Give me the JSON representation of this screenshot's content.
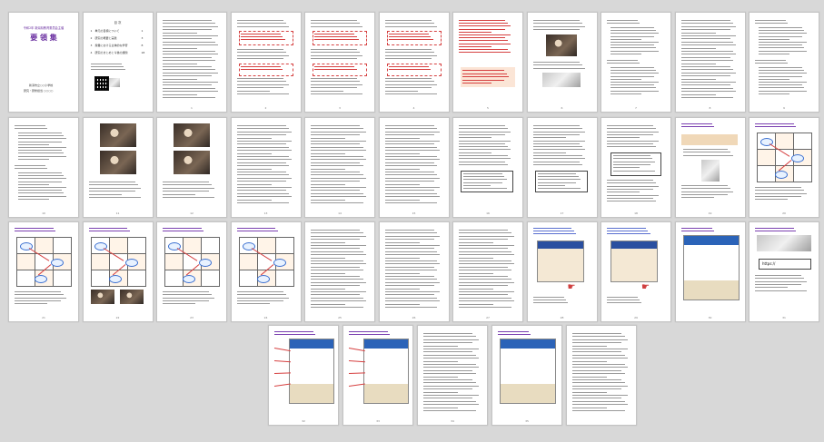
{
  "viewer": {
    "title": "",
    "layout": "thumbnail-grid",
    "background_color": "#d8d8d8",
    "accent_color": "#6a2fa0",
    "highlight_color": "#d64040"
  },
  "cover": {
    "line1": "令和2年 新潟県教育委員会主催",
    "line2": "要 領 集",
    "line3": "新潟市立○○小学校",
    "line4": "研究・研修担当 ○○○○"
  },
  "toc": {
    "heading": "目 次",
    "items": [
      {
        "no": "1",
        "text": "単元の目標について",
        "page": "1"
      },
      {
        "no": "2",
        "text": "研究の概要と実践",
        "page": "3"
      },
      {
        "no": "3",
        "text": "授業における主体的な学習",
        "page": "8"
      },
      {
        "no": "4",
        "text": "研究のまとめと今後の課題",
        "page": "18"
      }
    ]
  },
  "headings": {
    "p3": "1.単元の目標について",
    "p4": "(1) 単元の評価規準を設定する",
    "p5": "(2) Google Classroomの活用",
    "p6": "(3) 学習の記録と評価",
    "p7": "(4) 振り返りシートの作成",
    "p10": "研究テーマ",
    "p11": "2.研究の概要と実践",
    "p12": "(1) 研究の目的",
    "p15": "3.研究の成果と課題",
    "p19": "(2) 研究の内容と方法",
    "p20": "(3) 授業の実際",
    "p22": "4.研究のまとめ",
    "p23": "新潟市立ネットの案内",
    "p24": "(4) 学習の成果を共有する",
    "p25": "(5) 学習活動を分類する",
    "p26": "(6) 活動の整理",
    "p34": "(7) 実践の事例",
    "p36": "URL 入力画面",
    "p37": "https://"
  },
  "page_numbers": [
    "",
    "",
    "1",
    "2",
    "3",
    "4",
    "5",
    "6",
    "7",
    "8",
    "9",
    "10",
    "11",
    "12",
    "13",
    "14",
    "15",
    "16",
    "17",
    "18",
    "19",
    "20",
    "21",
    "22",
    "23",
    "24",
    "25",
    "26",
    "27",
    "28",
    "29",
    "30",
    "31",
    "32",
    "33",
    "34",
    "35",
    ""
  ],
  "thumbnails": [
    {
      "name": "page-1",
      "kind": "cover"
    },
    {
      "name": "page-2",
      "kind": "toc"
    },
    {
      "name": "page-3",
      "kind": "text"
    },
    {
      "name": "page-4",
      "kind": "text-redbox"
    },
    {
      "name": "page-5",
      "kind": "text-redbox"
    },
    {
      "name": "page-6",
      "kind": "text-redbox"
    },
    {
      "name": "page-7",
      "kind": "text-red-photo"
    },
    {
      "name": "page-8",
      "kind": "photo-text"
    },
    {
      "name": "page-9",
      "kind": "text-list"
    },
    {
      "name": "page-10",
      "kind": "text"
    },
    {
      "name": "page-11",
      "kind": "text-list"
    },
    {
      "name": "page-12",
      "kind": "text-list"
    },
    {
      "name": "page-13",
      "kind": "photos"
    },
    {
      "name": "page-14",
      "kind": "photos"
    },
    {
      "name": "page-15",
      "kind": "text"
    },
    {
      "name": "page-16",
      "kind": "text"
    },
    {
      "name": "page-17",
      "kind": "text"
    },
    {
      "name": "page-18",
      "kind": "text-box"
    },
    {
      "name": "page-19",
      "kind": "text-box"
    },
    {
      "name": "page-20",
      "kind": "text-photo"
    },
    {
      "name": "page-21",
      "kind": "poster"
    },
    {
      "name": "page-22",
      "kind": "diagram"
    },
    {
      "name": "page-23",
      "kind": "diagram"
    },
    {
      "name": "page-24",
      "kind": "diagram-photos"
    },
    {
      "name": "page-25",
      "kind": "diagram"
    },
    {
      "name": "page-26",
      "kind": "diagram"
    },
    {
      "name": "page-27",
      "kind": "text"
    },
    {
      "name": "page-28",
      "kind": "text"
    },
    {
      "name": "page-29",
      "kind": "text"
    },
    {
      "name": "page-30",
      "kind": "screenshot-hand"
    },
    {
      "name": "page-31",
      "kind": "screenshot-hand"
    },
    {
      "name": "page-32",
      "kind": "screenshot"
    },
    {
      "name": "page-33",
      "kind": "url-input"
    },
    {
      "name": "page-34",
      "kind": "screenshot-arrows"
    },
    {
      "name": "page-35",
      "kind": "screenshot-arrows"
    },
    {
      "name": "page-36",
      "kind": "text"
    },
    {
      "name": "page-37",
      "kind": "screenshot"
    },
    {
      "name": "page-38",
      "kind": "text"
    }
  ]
}
